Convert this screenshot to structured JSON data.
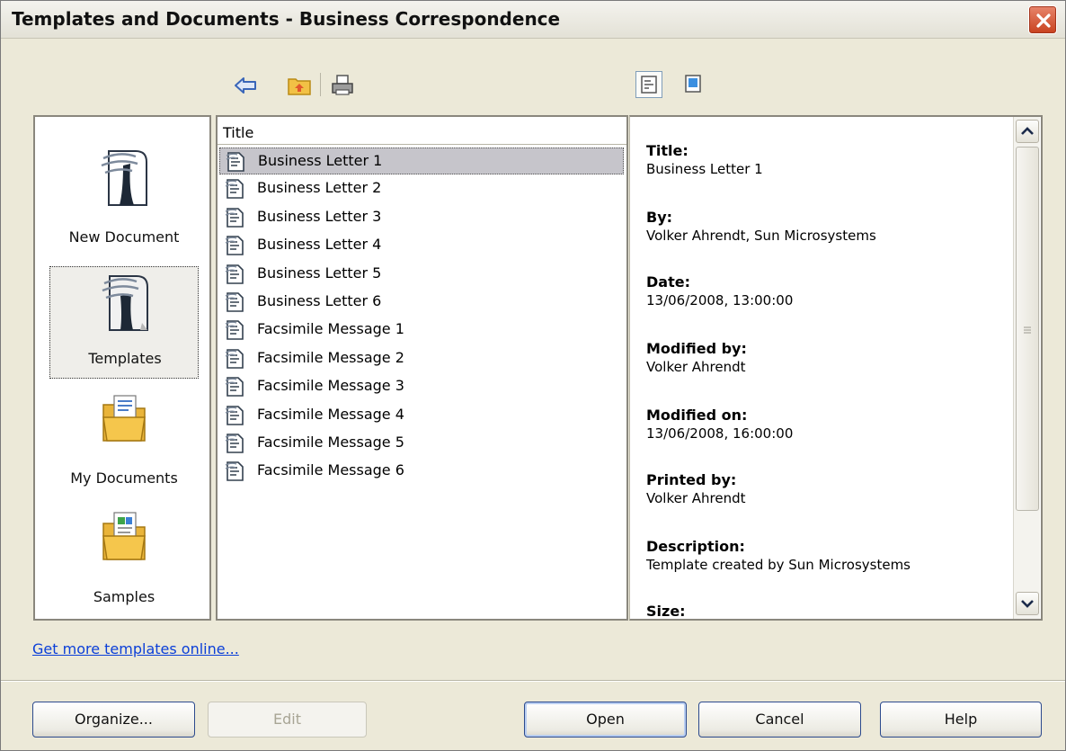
{
  "window": {
    "title": "Templates and Documents - Business Correspondence"
  },
  "toolbar": {
    "back_icon": "back-arrow-icon",
    "up_icon": "folder-up-icon",
    "print_icon": "print-icon",
    "view_document_icon": "document-properties-icon",
    "view_preview_icon": "preview-icon"
  },
  "categories": [
    {
      "label": "New Document",
      "icon": "new-document-icon",
      "selected": false
    },
    {
      "label": "Templates",
      "icon": "templates-icon",
      "selected": true
    },
    {
      "label": "My Documents",
      "icon": "folder-documents-icon",
      "selected": false
    },
    {
      "label": "Samples",
      "icon": "folder-samples-icon",
      "selected": false
    }
  ],
  "list": {
    "header": "Title",
    "items": [
      "Business Letter 1",
      "Business Letter 2",
      "Business Letter 3",
      "Business Letter 4",
      "Business Letter 5",
      "Business Letter 6",
      "Facsimile Message 1",
      "Facsimile Message 2",
      "Facsimile Message 3",
      "Facsimile Message 4",
      "Facsimile Message 5",
      "Facsimile Message 6"
    ],
    "selected_index": 0
  },
  "info": {
    "title_label": "Title:",
    "title_value": "Business Letter 1",
    "by_label": "By:",
    "by_value": "Volker Ahrendt, Sun Microsystems",
    "date_label": "Date:",
    "date_value": "13/06/2008, 13:00:00",
    "modified_by_label": "Modified by:",
    "modified_by_value": "Volker Ahrendt",
    "modified_on_label": "Modified on:",
    "modified_on_value": "13/06/2008, 16:00:00",
    "printed_by_label": "Printed by:",
    "printed_by_value": "Volker Ahrendt",
    "description_label": "Description:",
    "description_value": "Template created by Sun Microsystems",
    "size_label": "Size:"
  },
  "links": {
    "more_templates": "Get more templates online..."
  },
  "buttons": {
    "organize": "Organize...",
    "edit": "Edit",
    "open": "Open",
    "cancel": "Cancel",
    "help": "Help"
  },
  "colors": {
    "dialog_bg": "#ece9d8",
    "link": "#0b3fd8",
    "close_btn": "#c8411e",
    "selection": "#c6c5cb"
  }
}
